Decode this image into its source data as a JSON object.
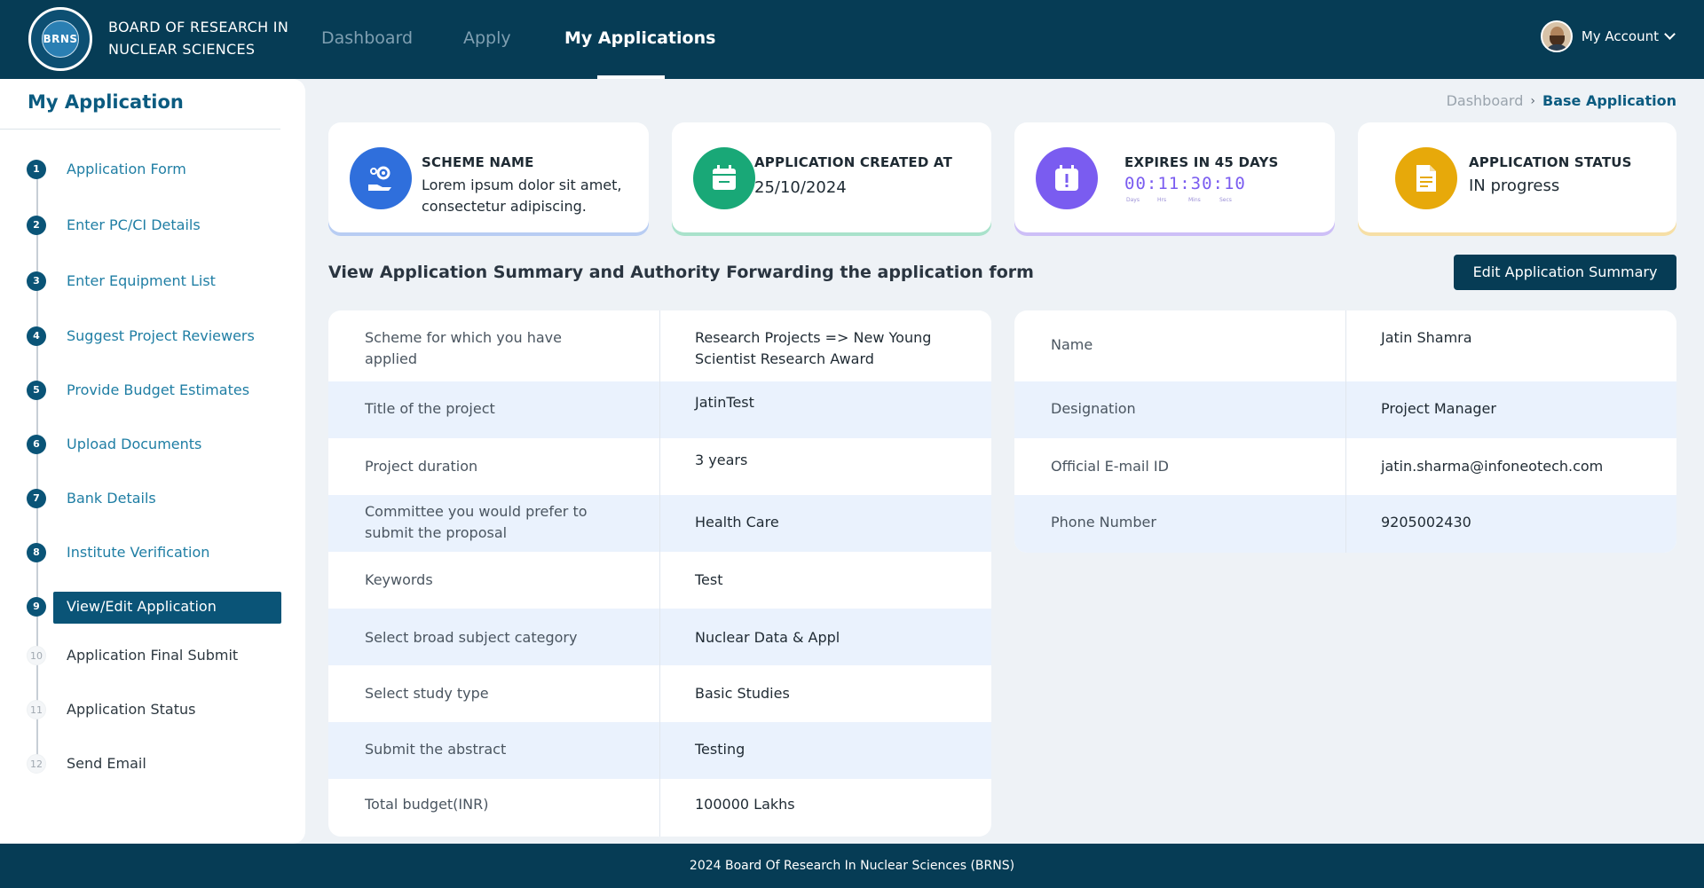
{
  "header": {
    "logo_text": "BRNS",
    "org_name": "BOARD OF RESEARCH IN NUCLEAR SCIENCES",
    "nav": {
      "dashboard": "Dashboard",
      "apply": "Apply",
      "my_applications": "My Applications"
    },
    "account_label": "My Account"
  },
  "sidebar": {
    "title": "My Application",
    "steps": [
      {
        "num": "1",
        "label": "Application Form",
        "state": "done"
      },
      {
        "num": "2",
        "label": "Enter PC/CI Details",
        "state": "done"
      },
      {
        "num": "3",
        "label": "Enter Equipment List",
        "state": "done"
      },
      {
        "num": "4",
        "label": "Suggest Project Reviewers",
        "state": "done"
      },
      {
        "num": "5",
        "label": "Provide Budget Estimates",
        "state": "done"
      },
      {
        "num": "6",
        "label": "Upload Documents",
        "state": "done"
      },
      {
        "num": "7",
        "label": "Bank Details",
        "state": "done"
      },
      {
        "num": "8",
        "label": "Institute Verification",
        "state": "done"
      },
      {
        "num": "9",
        "label": "View/Edit Application",
        "state": "active"
      },
      {
        "num": "10",
        "label": "Application Final Submit",
        "state": "pending"
      },
      {
        "num": "11",
        "label": "Application Status",
        "state": "pending"
      },
      {
        "num": "12",
        "label": "Send Email",
        "state": "pending"
      }
    ]
  },
  "breadcrumb": {
    "parent": "Dashboard",
    "current": "Base Application"
  },
  "cards": {
    "scheme": {
      "title": "SCHEME NAME",
      "value": "Lorem ipsum dolor sit amet, consectetur adipiscing.",
      "color": "#2f6fdc"
    },
    "created": {
      "title": "APPLICATION CREATED AT",
      "value": "25/10/2024",
      "color": "#19a877"
    },
    "expires": {
      "title": "EXPIRES IN 45 DAYS",
      "timer": "00:11:30:10",
      "units": [
        "Days",
        "Hrs",
        "Mins",
        "Secs"
      ],
      "color": "#7a5cf0"
    },
    "status": {
      "title": "APPLICATION STATUS",
      "value": "IN progress",
      "color": "#e7a90a"
    }
  },
  "section": {
    "title": "View Application Summary and Authority Forwarding the application form",
    "edit_button": "Edit Application Summary"
  },
  "project_table": [
    {
      "label": "Scheme for which you have applied",
      "value": "Research Projects => New Young Scientist Research Award"
    },
    {
      "label": "Title of the project",
      "value": "JatinTest"
    },
    {
      "label": "Project duration",
      "value": "3 years"
    },
    {
      "label": "Committee you would prefer to submit the proposal",
      "value": "Health Care"
    },
    {
      "label": "Keywords",
      "value": "Test"
    },
    {
      "label": "Select broad subject category",
      "value": "Nuclear Data & Appl"
    },
    {
      "label": "Select study type",
      "value": "Basic Studies"
    },
    {
      "label": "Submit the abstract",
      "value": "Testing"
    },
    {
      "label": "Total budget(INR)",
      "value": "100000 Lakhs"
    }
  ],
  "person_table": [
    {
      "label": "Name",
      "value": "Jatin Shamra"
    },
    {
      "label": "Designation",
      "value": "Project Manager"
    },
    {
      "label": "Official E-mail ID",
      "value": "jatin.sharma@infoneotech.com"
    },
    {
      "label": "Phone Number",
      "value": "9205002430"
    }
  ],
  "footer": {
    "text": "2024 Board Of Research In Nuclear Sciences (BRNS)"
  }
}
